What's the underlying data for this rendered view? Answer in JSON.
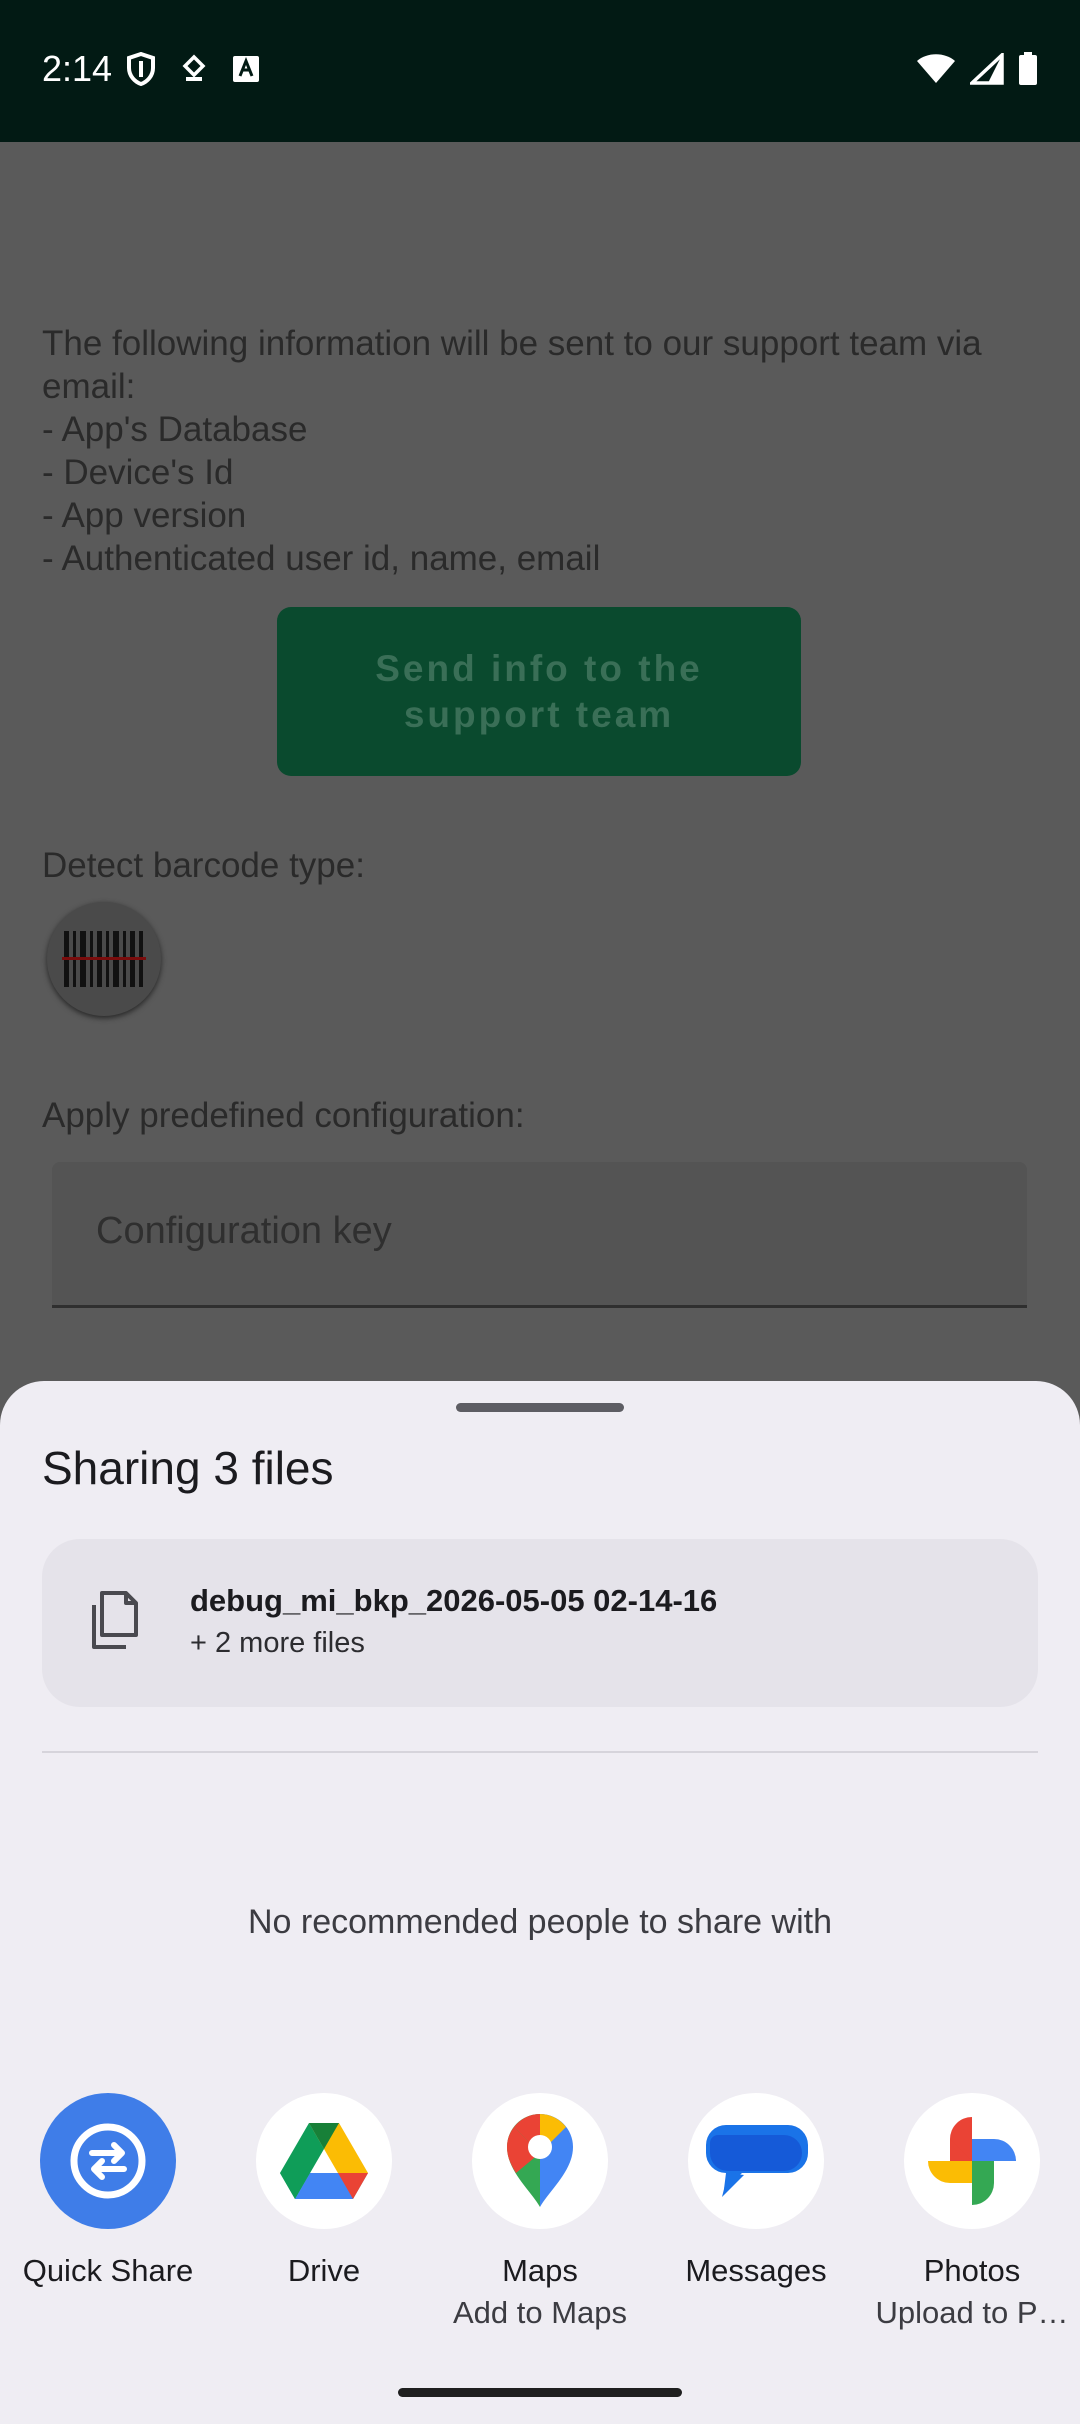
{
  "status_bar": {
    "time": "2:14"
  },
  "app": {
    "info_text": "The following information will be sent to our support team via email:\n - App's Database\n - Device's Id\n - App version\n - Authenticated user id, name, email",
    "send_button_label": "Send info to the support team",
    "detect_barcode_label": "Detect barcode type:",
    "apply_config_label": "Apply predefined configuration:",
    "config_placeholder": "Configuration key"
  },
  "share_sheet": {
    "title": "Sharing 3 files",
    "file_name": "debug_mi_bkp_2026-05-05 02-14-16",
    "file_more": "+ 2 more files",
    "no_people": "No recommended people to share with",
    "targets": [
      {
        "label": "Quick Share",
        "sub": "",
        "icon": "quick-share-icon"
      },
      {
        "label": "Drive",
        "sub": "",
        "icon": "drive-icon"
      },
      {
        "label": "Maps",
        "sub": "Add to Maps",
        "icon": "maps-icon"
      },
      {
        "label": "Messages",
        "sub": "",
        "icon": "messages-icon"
      },
      {
        "label": "Photos",
        "sub": "Upload to P…",
        "icon": "photos-icon"
      }
    ]
  },
  "colors": {
    "status_bar_bg": "#021a14",
    "scrim": "#5a5a5a",
    "send_button": "#0a4a2e",
    "sheet_bg": "#efedf3",
    "quick_share_blue": "#3f7de8"
  }
}
